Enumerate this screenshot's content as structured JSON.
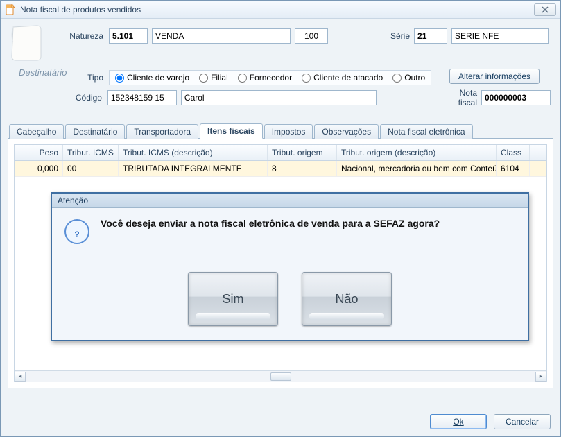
{
  "window": {
    "title": "Nota fiscal de produtos vendidos"
  },
  "header": {
    "natureza_label": "Natureza",
    "natureza_code": "5.101",
    "natureza_desc": "VENDA",
    "natureza_extra": "100",
    "serie_label": "Série",
    "serie_code": "21",
    "serie_desc": "SERIE NFE",
    "destinatario_label": "Destinatário",
    "alterar_label": "Alterar informações",
    "tipo_label": "Tipo",
    "tipo_options": [
      "Cliente de varejo",
      "Filial",
      "Fornecedor",
      "Cliente de atacado",
      "Outro"
    ],
    "codigo_label": "Código",
    "codigo_value": "152348159 15",
    "codigo_nome": "Carol",
    "nota_fiscal_label": "Nota fiscal",
    "nota_fiscal_value": "000000003"
  },
  "tabs": [
    "Cabeçalho",
    "Destinatário",
    "Transportadora",
    "Itens fiscais",
    "Impostos",
    "Observações",
    "Nota fiscal eletrônica"
  ],
  "active_tab": "Itens fiscais",
  "grid": {
    "columns": [
      "Peso",
      "Tribut. ICMS",
      "Tribut. ICMS (descrição)",
      "Tribut. origem",
      "Tribut. origem (descrição)",
      "Class"
    ],
    "row": {
      "peso": "0,000",
      "tribut_icms": "00",
      "tribut_icms_desc": "TRIBUTADA INTEGRALMENTE",
      "tribut_origem": "8",
      "tribut_origem_desc": "Nacional, mercadoria ou bem com Conteúdo de Importaçã",
      "class": "6104"
    }
  },
  "dialog": {
    "title": "Atenção",
    "message": "Você deseja enviar a nota fiscal eletrônica de venda para a SEFAZ agora?",
    "yes": "Sim",
    "no": "Não"
  },
  "footer": {
    "ok": "Ok",
    "cancel": "Cancelar"
  }
}
